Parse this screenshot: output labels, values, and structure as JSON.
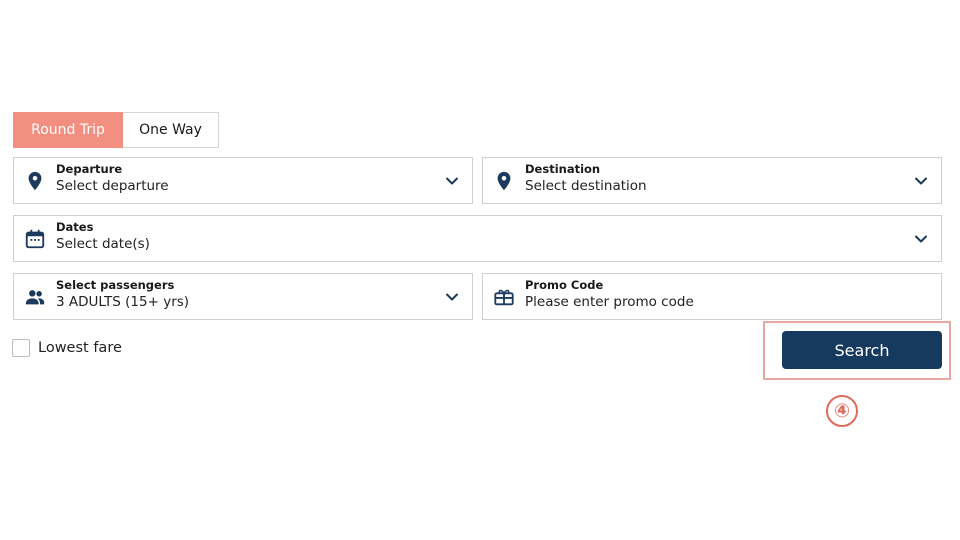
{
  "trip_type": {
    "round_trip": "Round Trip",
    "one_way": "One Way",
    "selected": "Round Trip"
  },
  "departure": {
    "label": "Departure",
    "placeholder": "Select departure",
    "icon": "map-pin-icon"
  },
  "destination": {
    "label": "Destination",
    "placeholder": "Select destination",
    "icon": "map-pin-icon"
  },
  "dates": {
    "label": "Dates",
    "placeholder": "Select date(s)",
    "icon": "calendar-icon"
  },
  "passengers": {
    "label": "Select passengers",
    "value": "3 ADULTS (15+ yrs)",
    "icon": "people-icon"
  },
  "promo": {
    "label": "Promo Code",
    "placeholder": "Please enter promo code",
    "icon": "gift-card-icon"
  },
  "lowest_fare": {
    "label": "Lowest fare",
    "checked": false
  },
  "search": {
    "label": "Search"
  },
  "annotation": {
    "step": "④"
  },
  "colors": {
    "accent": "#f28f80",
    "primary": "#163a5f",
    "icon": "#1b3a5c",
    "highlight": "#e9a7a2",
    "marker": "#e06a5c"
  }
}
